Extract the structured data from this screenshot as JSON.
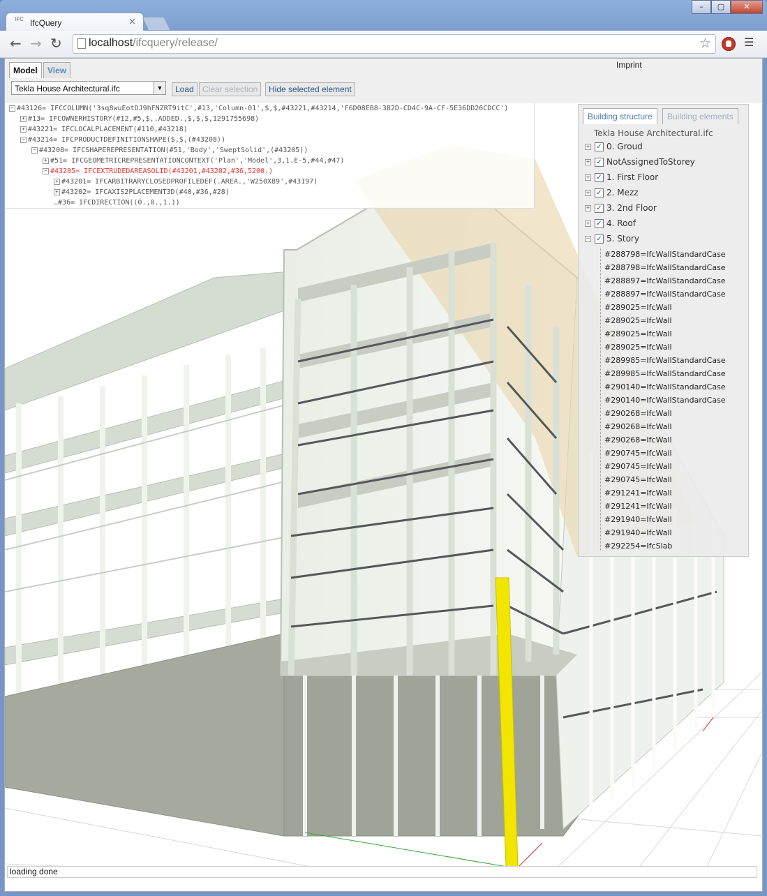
{
  "browser": {
    "tab_title": "IfcQuery",
    "tab_favicon": "IFC",
    "url_host": "localhost",
    "url_path": "/ifcquery/release/",
    "window_controls": [
      "minimize-icon",
      "maximize-icon",
      "close-icon"
    ]
  },
  "app": {
    "tabs": [
      {
        "label": "Model"
      },
      {
        "label": "View"
      }
    ],
    "imprint_label": "Imprint",
    "file_select": "Tekla House Architectural.ifc",
    "buttons": {
      "load": "Load",
      "clear_selection": "Clear selection",
      "hide_selected": "Hide selected element"
    },
    "status_text": "loading done"
  },
  "entity_tree": [
    {
      "text": "#43126= IFCCOLUMN('3sq8wuEotDJ9hFNZRT9itC',#13,'Column-01',$,$,#43221,#43214,'F6D08EB8-3B2D-CD4C-9A-CF-5E36DD26CDCC')",
      "toggle": "−"
    },
    {
      "text": "#13= IFCOWNERHISTORY(#12,#5,$,.ADDED.,$,$,$,1291755698)",
      "toggle": "+"
    },
    {
      "text": "#43221= IFCLOCALPLACEMENT(#110,#43218)",
      "toggle": "+"
    },
    {
      "text": "#43214= IFCPRODUCTDEFINITIONSHAPE($,$,(#43208))",
      "toggle": "−"
    },
    {
      "text": "#43208= IFCSHAPEREPRESENTATION(#51,'Body','SweptSolid',(#43205))",
      "toggle": "−"
    },
    {
      "text": "#51= IFCGEOMETRICREPRESENTATIONCONTEXT('Plan','Model',3,1.E-5,#44,#47)",
      "toggle": "+"
    },
    {
      "text": "#43205= IFCEXTRUDEDAREASOLID(#43201,#43202,#36,5200.)",
      "toggle": "−"
    },
    {
      "text": "#43201= IFCARBITRARYCLOSEDPROFILEDEF(.AREA.,'W250X89',#43197)",
      "toggle": "+"
    },
    {
      "text": "#43202= IFCAXIS2PLACEMENT3D(#40,#36,#28)",
      "toggle": "+"
    },
    {
      "text": "#36= IFCDIRECTION((0.,0.,1.))",
      "toggle": ""
    }
  ],
  "side_panel": {
    "tabs": [
      {
        "label": "Building structure"
      },
      {
        "label": "Building elements"
      }
    ],
    "root": "Tekla House Architectural.ifc",
    "stories": [
      {
        "label": "0. Groud",
        "checked": true
      },
      {
        "label": "NotAssignedToStorey",
        "checked": true
      },
      {
        "label": "1. First Floor",
        "checked": true
      },
      {
        "label": "2. Mezz",
        "checked": true
      },
      {
        "label": "3. 2nd Floor",
        "checked": true
      },
      {
        "label": "4. Roof",
        "checked": true
      },
      {
        "label": "5. Story",
        "checked": true
      }
    ],
    "elements": [
      "#288798=IfcWallStandardCase",
      "#288798=IfcWallStandardCase",
      "#288897=IfcWallStandardCase",
      "#288897=IfcWallStandardCase",
      "#289025=IfcWall",
      "#289025=IfcWall",
      "#289025=IfcWall",
      "#289025=IfcWall",
      "#289985=IfcWallStandardCase",
      "#289985=IfcWallStandardCase",
      "#290140=IfcWallStandardCase",
      "#290140=IfcWallStandardCase",
      "#290268=IfcWall",
      "#290268=IfcWall",
      "#290268=IfcWall",
      "#290745=IfcWall",
      "#290745=IfcWall",
      "#290745=IfcWall",
      "#291241=IfcWall",
      "#291241=IfcWall",
      "#291940=IfcWall",
      "#291940=IfcWall",
      "#292254=IfcSlab"
    ]
  },
  "colors": {
    "selected_column": "#f2e600",
    "structure": "#dfe6dc",
    "slab": "#a6aa9e",
    "highlight_text": "#e33333"
  }
}
